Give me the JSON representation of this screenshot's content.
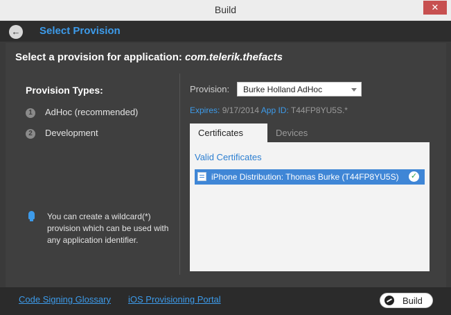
{
  "window": {
    "title": "Build",
    "close_glyph": "✕"
  },
  "header": {
    "back_glyph": "←",
    "title": "Select Provision"
  },
  "main": {
    "heading_prefix": "Select a provision for application: ",
    "app_id": "com.telerik.thefacts"
  },
  "left": {
    "label": "Provision Types:",
    "steps": [
      {
        "num": "1",
        "label": "AdHoc (recommended)"
      },
      {
        "num": "2",
        "label": "Development"
      }
    ],
    "tip": "You can create a wildcard(*) provision which can be used with any application identifier."
  },
  "right": {
    "provision_label": "Provision:",
    "provision_selected": "Burke Holland AdHoc",
    "expires_label": "Expires:",
    "expires_value": "9/17/2014",
    "appid_label": "App ID:",
    "appid_value": "T44FP8YU5S.*",
    "tabs": [
      {
        "label": "Certificates",
        "active": true
      },
      {
        "label": "Devices",
        "active": false
      }
    ],
    "valid_label": "Valid Certificates",
    "certificate": "iPhone Distribution: Thomas Burke (T44FP8YU5S)",
    "check_glyph": "✓"
  },
  "footer": {
    "links": [
      "Code Signing Glossary",
      "iOS Provisioning Portal"
    ],
    "build_label": "Build"
  },
  "colors": {
    "accent": "#3d9bea",
    "selection": "#3f86d6",
    "panel": "#3f3f3f"
  },
  "icons": [
    "back-arrow-icon",
    "close-icon",
    "lightbulb-icon",
    "certificate-icon",
    "check-icon",
    "build-icon"
  ]
}
